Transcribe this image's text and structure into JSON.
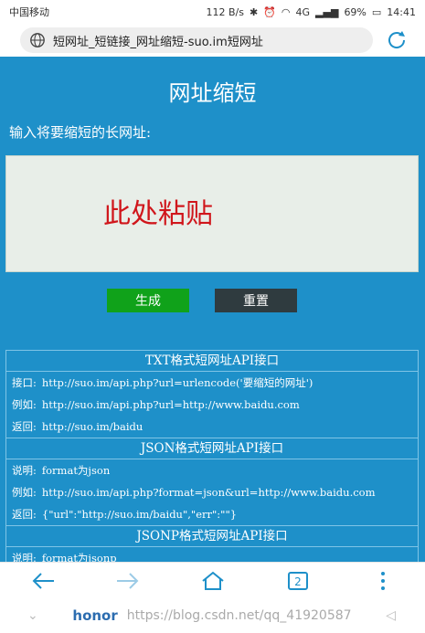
{
  "status_bar": {
    "carrier": "中国移动",
    "speed": "112 B/s",
    "network": "4G",
    "battery": "69%",
    "time": "14:41"
  },
  "browser": {
    "url_title": "短网址_短链接_网址缩短-suo.im短网址"
  },
  "page": {
    "title": "网址缩短",
    "prompt": "输入将要缩短的长网址:",
    "input_placeholder": "此处粘贴",
    "generate_label": "生成",
    "reset_label": "重置"
  },
  "api": {
    "txt": {
      "title": "TXT格式短网址API接口",
      "rows": [
        {
          "key": "接口:",
          "value": "http://suo.im/api.php?url=urlencode('要缩短的网址')"
        },
        {
          "key": "例如:",
          "value": "http://suo.im/api.php?url=http://www.baidu.com"
        },
        {
          "key": "返回:",
          "value": "http://suo.im/baidu"
        }
      ]
    },
    "json": {
      "title": "JSON格式短网址API接口",
      "rows": [
        {
          "key": "说明:",
          "value": "format为json"
        },
        {
          "key": "例如:",
          "value": "http://suo.im/api.php?format=json&url=http://www.baidu.com"
        },
        {
          "key": "返回:",
          "value": "{\"url\":\"http://suo.im/baidu\",\"err\":\"\"}"
        }
      ]
    },
    "jsonp": {
      "title": "JSONP格式短网址API接口",
      "rows": [
        {
          "key": "说明:",
          "value": "format为jsonp"
        }
      ]
    }
  },
  "nav": {
    "tab_count": "2"
  },
  "system_bar": {
    "brand": "honor",
    "watermark": "https://blog.csdn.net/qq_41920587"
  },
  "colors": {
    "page_bg": "#1e90c9",
    "generate_btn": "#10a21a",
    "reset_btn": "#2f3b3f",
    "placeholder": "#d0161b"
  }
}
